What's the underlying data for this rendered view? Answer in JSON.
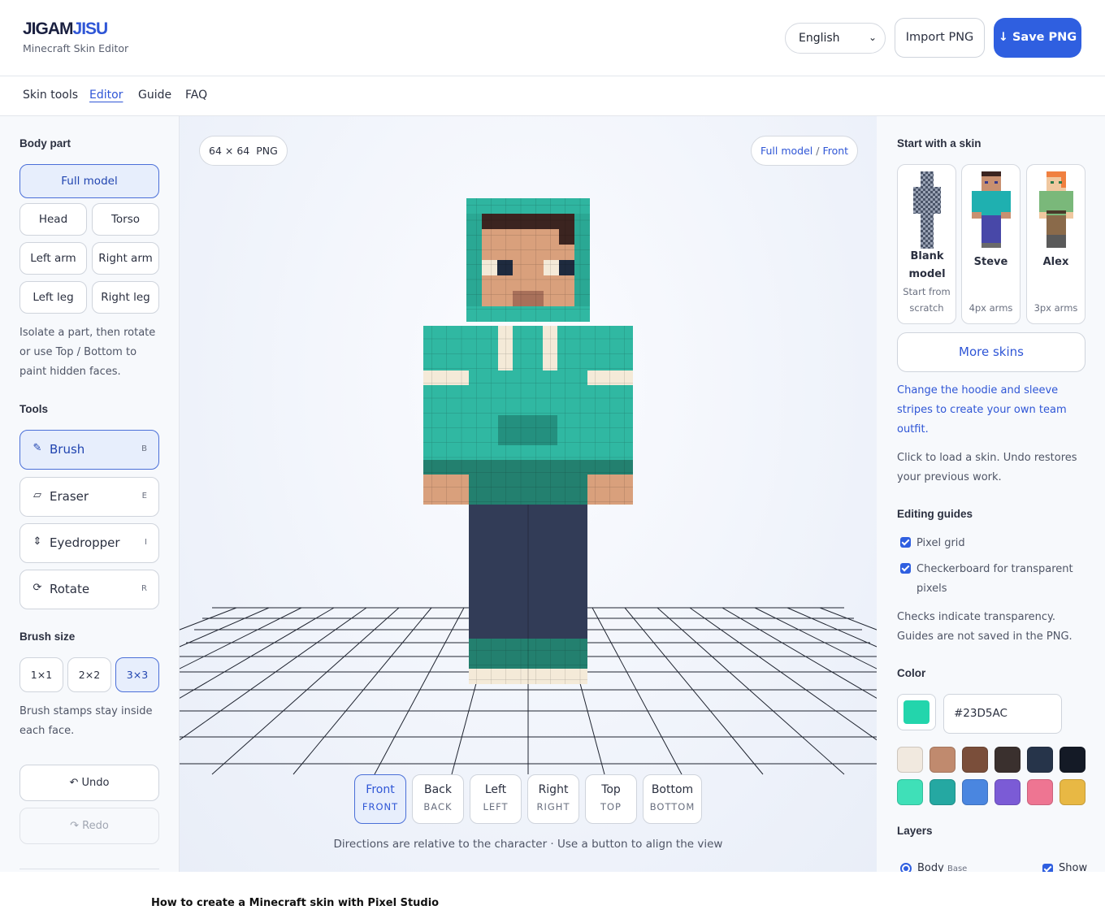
{
  "brand": {
    "name_part1": "JIGAM",
    "name_part2": "JISU",
    "subtitle": "Minecraft Skin Editor"
  },
  "header": {
    "language": "English",
    "import_label": "Import PNG",
    "save_label": "↓ Save PNG"
  },
  "nav": {
    "items": [
      "Skin tools",
      "Editor",
      "Guide",
      "FAQ"
    ],
    "active": "Editor"
  },
  "left_panel": {
    "body_part_title": "Body part",
    "body_parts": [
      "Full model",
      "Head",
      "Torso",
      "Left arm",
      "Right arm",
      "Left leg",
      "Right leg"
    ],
    "selected_body_part": "Full model",
    "body_part_note": "Isolate a part, then rotate or use Top / Bottom to paint hidden faces.",
    "tools_title": "Tools",
    "tools": [
      {
        "label": "Brush",
        "shortcut": "B",
        "icon": "brush-icon"
      },
      {
        "label": "Eraser",
        "shortcut": "E",
        "icon": "eraser-icon"
      },
      {
        "label": "Eyedropper",
        "shortcut": "I",
        "icon": "eyedropper-icon"
      },
      {
        "label": "Rotate",
        "shortcut": "R",
        "icon": "rotate-icon"
      }
    ],
    "selected_tool": "Brush",
    "brush_size_title": "Brush size",
    "brush_sizes": [
      "1×1",
      "2×2",
      "3×3"
    ],
    "selected_brush_size": "3×3",
    "brush_note": "Brush stamps stay inside each face.",
    "undo_label": "↶ Undo",
    "redo_label": "↷ Redo"
  },
  "stage": {
    "size_chip": "64 × 64",
    "format_chip": "PNG",
    "view_chip_model": "Full model",
    "view_chip_sep": "/",
    "view_chip_face": "Front",
    "view_buttons": [
      {
        "label": "Front",
        "sub": "FRONT"
      },
      {
        "label": "Back",
        "sub": "BACK"
      },
      {
        "label": "Left",
        "sub": "LEFT"
      },
      {
        "label": "Right",
        "sub": "RIGHT"
      },
      {
        "label": "Top",
        "sub": "TOP"
      },
      {
        "label": "Bottom",
        "sub": "BOTTOM"
      }
    ],
    "selected_view": "Front",
    "hint": "Directions are relative to the character · Use a button to align the view"
  },
  "right_panel": {
    "start_title": "Start with a skin",
    "skins": [
      {
        "name": "Blank model",
        "desc": "Start from scratch"
      },
      {
        "name": "Steve",
        "desc": "4px arms"
      },
      {
        "name": "Alex",
        "desc": "3px arms"
      }
    ],
    "more_skins_label": "More skins",
    "promo_text": "Change the hoodie and sleeve stripes to create your own team outfit.",
    "load_note": "Click to load a skin. Undo restores your previous work.",
    "guides_title": "Editing guides",
    "guides": [
      {
        "label": "Pixel grid",
        "checked": true
      },
      {
        "label": "Checkerboard for transparent pixels",
        "checked": true
      }
    ],
    "guides_note": "Checks indicate transparency. Guides are not saved in the PNG.",
    "color_title": "Color",
    "current_color": "#23D5AC",
    "palette": [
      "#F1E9DF",
      "#C08A6E",
      "#7A4E3A",
      "#3A302E",
      "#26344A",
      "#141A26",
      "#3FE0B8",
      "#25A8A2",
      "#4A86E0",
      "#7B5BD6",
      "#EE7592",
      "#E8B844"
    ],
    "layers_title": "Layers",
    "layer_name": "Body",
    "layer_sub": "Base",
    "layer_show": "Show"
  },
  "footer": {
    "heading": "How to create a Minecraft skin with Pixel Studio"
  }
}
